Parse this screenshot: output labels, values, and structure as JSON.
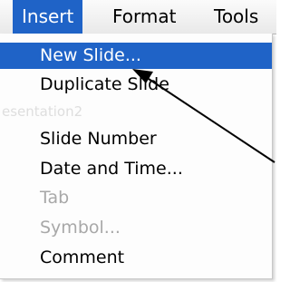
{
  "menubar": {
    "items": [
      {
        "label": "Insert",
        "active": true
      },
      {
        "label": "Format",
        "active": false
      },
      {
        "label": "Tools",
        "active": false
      }
    ]
  },
  "menu": {
    "items": [
      {
        "label": "New Slide...",
        "state": "selected"
      },
      {
        "label": "Duplicate Slide",
        "state": "enabled"
      },
      {
        "label": "Slide Number",
        "state": "enabled"
      },
      {
        "label": "Date and Time...",
        "state": "enabled"
      },
      {
        "label": "Tab",
        "state": "disabled"
      },
      {
        "label": "Symbol...",
        "state": "disabled"
      },
      {
        "label": "Comment",
        "state": "enabled"
      }
    ],
    "background_text": "esentation2"
  },
  "colors": {
    "highlight": "#1f63c7",
    "disabled_text": "#a8a8a8"
  }
}
